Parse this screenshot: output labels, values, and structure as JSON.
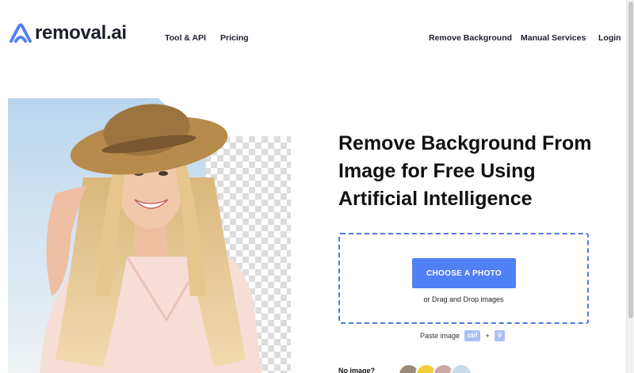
{
  "header": {
    "logo_text": "removal.ai",
    "nav_left": [
      {
        "label": "Tool & API"
      },
      {
        "label": "Pricing"
      }
    ],
    "nav_right": [
      {
        "label": "Remove Background"
      },
      {
        "label": "Manual Services"
      },
      {
        "label": "Login"
      }
    ]
  },
  "main": {
    "headline": "Remove Background From Image for Free Using Artificial Intelligence",
    "upload": {
      "button_label": "CHOOSE A PHOTO",
      "drag_text": "or Drag and Drop images"
    },
    "paste": {
      "label": "Paste image",
      "key_ctrl": "ctrl",
      "plus": "+",
      "key_v": "V"
    },
    "no_image_label": "No image?"
  },
  "colors": {
    "accent": "#4f80f5",
    "dropzone_border": "#4a7be6",
    "key_bg": "#a9c1f4",
    "text": "#111111"
  },
  "icons": [
    "removal-ai-logo-icon"
  ]
}
